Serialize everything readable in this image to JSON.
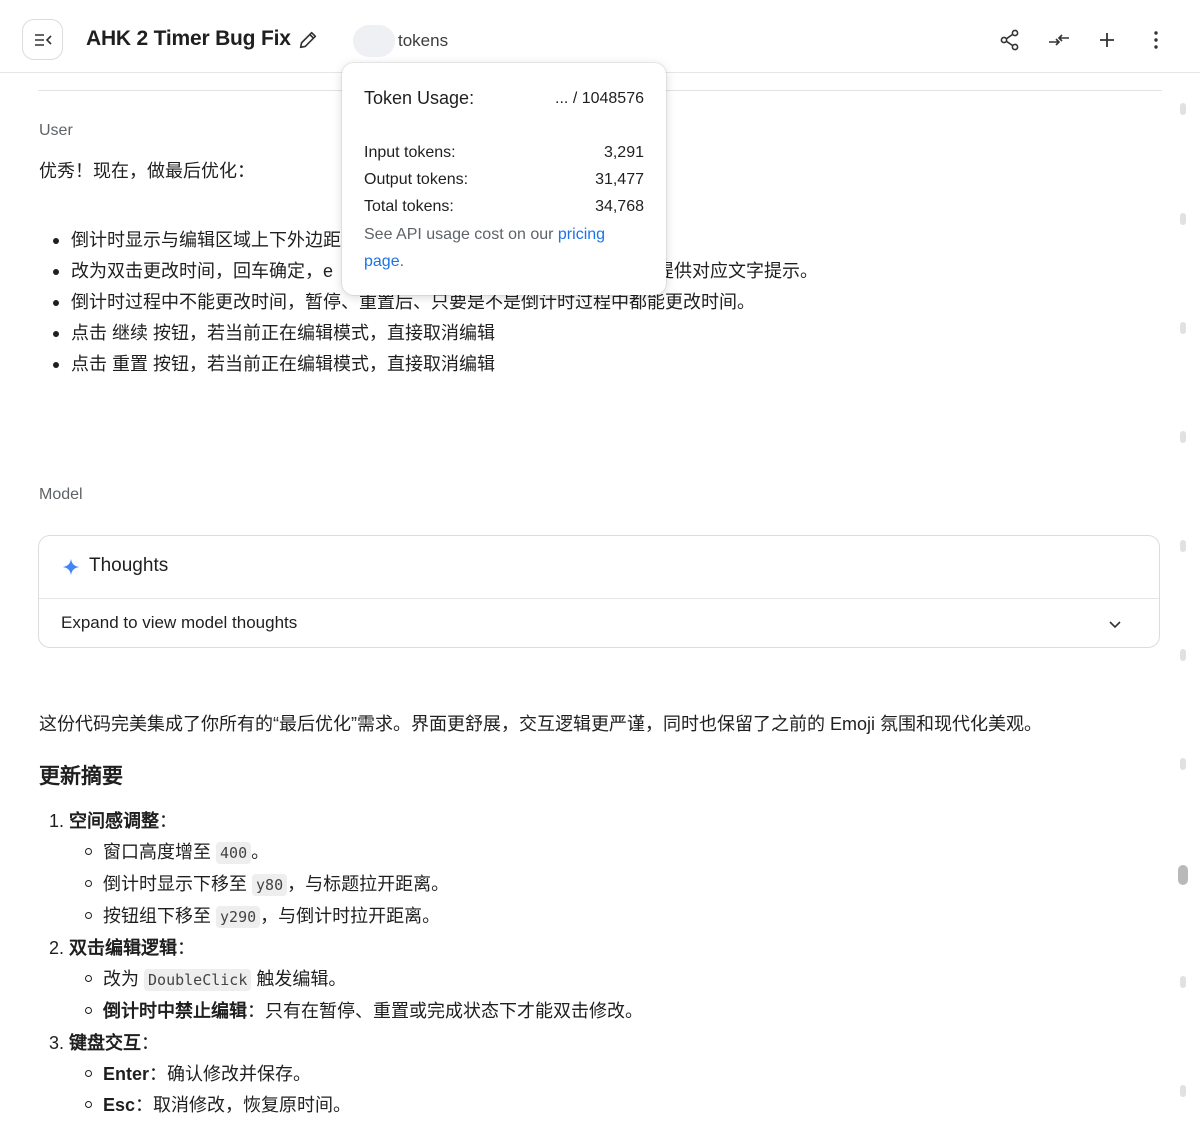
{
  "header": {
    "title": "AHK 2 Timer Bug Fix",
    "tokens_label": "tokens",
    "icons": [
      "sidebar-collapse-icon",
      "pencil-icon",
      "share-icon",
      "compare-icon",
      "plus-icon",
      "more-vertical-icon"
    ]
  },
  "token_popup": {
    "title": "Token Usage:",
    "limit": "... / 1048576",
    "rows": [
      {
        "label": "Input tokens:",
        "value": "3,291"
      },
      {
        "label": "Output tokens:",
        "value": "31,477"
      },
      {
        "label": "Total tokens:",
        "value": "34,768"
      }
    ],
    "cost_prefix": "See API usage cost on our ",
    "cost_link": "pricing page",
    "cost_suffix": "."
  },
  "user": {
    "role": "User",
    "text": "优秀！现在，做最后优化：",
    "bullets": [
      "倒计时显示与编辑区域上下外边距",
      "改为双击更改时间，回车确定，e",
      "倒计时过程中不能更改时间，暂停、重置后、只要是不是倒计时过程中都能更改时间。",
      "点击 继续 按钮，若当前正在编辑模式，直接取消编辑",
      "点击 重置 按钮，若当前正在编辑模式，直接取消编辑"
    ],
    "bullet2_tail": "部提供对应文字提示。"
  },
  "model": {
    "role": "Model",
    "thoughts_title": "Thoughts",
    "thoughts_expand": "Expand to view model thoughts",
    "intro": "这份代码完美集成了你所有的“最后优化”需求。界面更舒展，交互逻辑更严谨，同时也保留了之前的 Emoji 氛围和现代化美观。",
    "summary_heading": "更新摘要",
    "items": [
      {
        "num": "1.",
        "title": "空间感调整",
        "subs": [
          {
            "pre": "窗口高度增至 ",
            "code": "400",
            "post": "。"
          },
          {
            "pre": "倒计时显示下移至 ",
            "code": "y80",
            "post": "，与标题拉开距离。"
          },
          {
            "pre": "按钮组下移至 ",
            "code": "y290",
            "post": "，与倒计时拉开距离。"
          }
        ]
      },
      {
        "num": "2.",
        "title": "双击编辑逻辑",
        "subs": [
          {
            "pre": "改为 ",
            "code": "DoubleClick",
            "post": " 触发编辑。"
          },
          {
            "bold": "倒计时中禁止编辑",
            "post": "：只有在暂停、重置或完成状态下才能双击修改。"
          }
        ]
      },
      {
        "num": "3.",
        "title": "键盘交互",
        "subs": [
          {
            "bold": "Enter",
            "post": "：确认修改并保存。"
          },
          {
            "bold": "Esc",
            "post": "：取消修改，恢复原时间。"
          }
        ]
      }
    ],
    "colon": "："
  },
  "colors": {
    "accent_link": "#1a73e8",
    "sparkle": "#4285f4"
  }
}
